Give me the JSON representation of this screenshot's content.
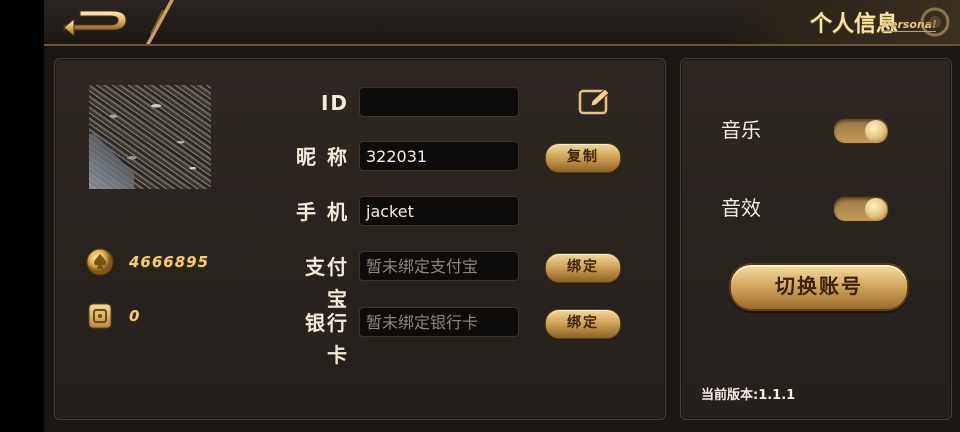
{
  "header": {
    "title": "个人信息",
    "title_en": "Personal",
    "back_icon": "back-arrow-icon"
  },
  "profile": {
    "avatar_desc": "avatar",
    "gold": "4666895",
    "card_count": "0"
  },
  "fields": [
    {
      "label": "ID",
      "value": "",
      "placeholder": ""
    },
    {
      "label": "昵 称",
      "value": "322031",
      "button": "复制"
    },
    {
      "label": "手 机",
      "value": "jacket"
    },
    {
      "label": "支付宝",
      "value": "暂未绑定支付宝",
      "button": "绑定",
      "placeholder_style": true
    },
    {
      "label": "银行卡",
      "value": "暂未绑定银行卡",
      "button": "绑定",
      "placeholder_style": true
    }
  ],
  "settings": {
    "music_label": "音乐",
    "music_on": true,
    "sfx_label": "音效",
    "sfx_on": true,
    "switch_account_label": "切换账号",
    "version_text": "当前版本:1.1.1"
  },
  "colors": {
    "gold": "#f2cf6e",
    "panel_bg": "#2a2420",
    "button_gold": "#d1a45a"
  }
}
